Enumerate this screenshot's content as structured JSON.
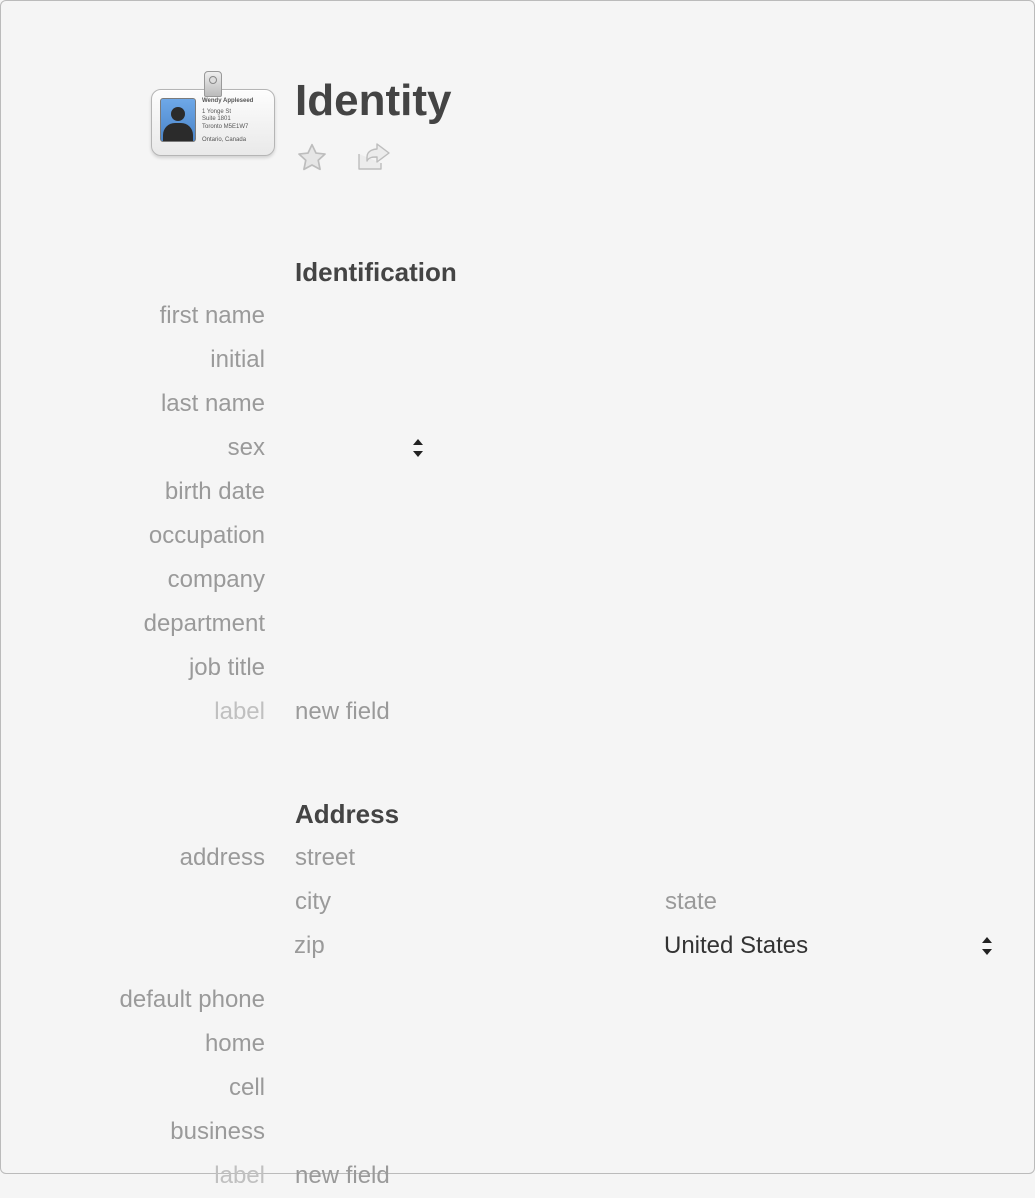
{
  "header": {
    "title": "Identity",
    "card": {
      "name": "Wendy Appleseed",
      "line1": "1 Yonge St",
      "line2": "Suite 1801",
      "line3": "Toronto M5E1W7",
      "line4": "Ontario, Canada"
    }
  },
  "sections": {
    "identification": {
      "title": "Identification",
      "fields": {
        "first_name": {
          "label": "first name",
          "value": ""
        },
        "initial": {
          "label": "initial",
          "value": ""
        },
        "last_name": {
          "label": "last name",
          "value": ""
        },
        "sex": {
          "label": "sex",
          "value": ""
        },
        "birth_date": {
          "label": "birth date",
          "value": ""
        },
        "occupation": {
          "label": "occupation",
          "value": ""
        },
        "company": {
          "label": "company",
          "value": ""
        },
        "department": {
          "label": "department",
          "value": ""
        },
        "job_title": {
          "label": "job title",
          "value": ""
        },
        "new": {
          "label": "label",
          "placeholder": "new field"
        }
      }
    },
    "address": {
      "title": "Address",
      "label": "address",
      "street_ph": "street",
      "city_ph": "city",
      "state_ph": "state",
      "zip_ph": "zip",
      "country": "United States",
      "phones": {
        "default_phone": {
          "label": "default phone",
          "value": ""
        },
        "home": {
          "label": "home",
          "value": ""
        },
        "cell": {
          "label": "cell",
          "value": ""
        },
        "business": {
          "label": "business",
          "value": ""
        },
        "new": {
          "label": "label",
          "placeholder": "new field"
        }
      }
    }
  }
}
